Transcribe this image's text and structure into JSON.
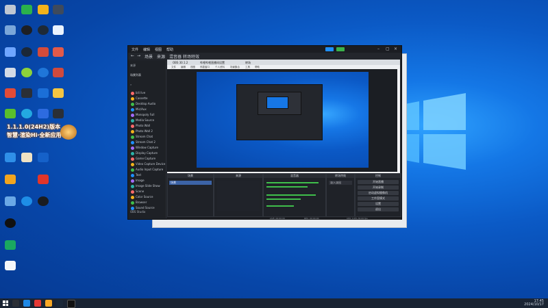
{
  "desktop": {
    "promo": {
      "line1": "1.1.1.0(24H2)版本",
      "line2": "智慧·渲染Hi·全新应用"
    }
  },
  "taskbar": {
    "tray_time": "17:45",
    "tray_date": "2024/10/17"
  },
  "obs": {
    "title_tabs": [
      "文件",
      "编辑",
      "视图",
      "帮助"
    ],
    "tabs": [
      "场景",
      "来源",
      "混音器",
      "转场特效"
    ],
    "sidebar_header": "来源",
    "sidebar_title": "场景列表",
    "sidebar_items": [
      "bili live",
      "Cassette",
      "Desktop Audio",
      "Mic/Aux",
      "Monopoly Full",
      "Media Source",
      "Photo Wall",
      "Photo Wall 2",
      "Stream Chat",
      "Stream Chat 2",
      "Window Capture",
      "Display Capture",
      "Game Capture",
      "Video Capture Device",
      "Audio Input Capture",
      "Text",
      "Image",
      "Image Slide Show",
      "Scene",
      "Color Source",
      "Browser",
      "Sound Source"
    ],
    "sidebar_footer": "OBS Studio",
    "browser_tabs": [
      "OBS 30.1.2",
      "哔哩哔哩直播间设置",
      "转场"
    ],
    "browser_menu": [
      "文件",
      "编辑",
      "视图",
      "停靠窗口",
      "个人资料",
      "场景集合",
      "工具",
      "帮助"
    ],
    "docks": {
      "scenes": "场景",
      "scenes_item": "场景",
      "sources": "来源",
      "mixer": "混音器",
      "transitions": "转场特效",
      "transition_value": "淡入淡出",
      "controls": "控制",
      "control_buttons": [
        "开始直播",
        "开始录制",
        "启动虚拟摄像机",
        "工作室模式",
        "设置",
        "退出"
      ]
    },
    "status": {
      "left": "LIVE: 00:00:00",
      "mid": "REC: 00:00:00",
      "right": "CPU: 0.8%  30.00 fps"
    }
  }
}
